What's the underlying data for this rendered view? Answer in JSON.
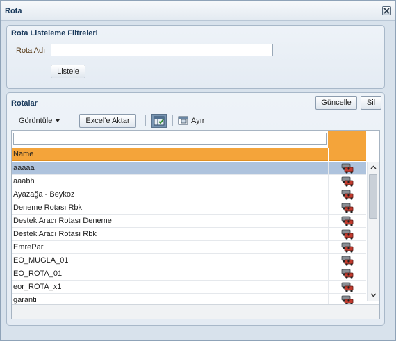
{
  "dialog": {
    "title": "Rota",
    "close_icon": "close-icon"
  },
  "filters": {
    "title": "Rota Listeleme Filtreleri",
    "route_name_label": "Rota Adı",
    "route_name_value": "",
    "list_button": "Listele"
  },
  "results": {
    "title": "Rotalar",
    "update_button": "Güncelle",
    "delete_button": "Sil",
    "toolbar": {
      "view_menu": "Görüntüle",
      "export_button": "Excel'e Aktar",
      "freeze_icon": "freeze-columns-icon",
      "detach_label": "Ayır",
      "detach_icon": "detach-icon"
    },
    "table": {
      "filter_value": "",
      "columns": [
        "Name",
        ""
      ],
      "row_action_icon": "route-vehicles-icon",
      "rows": [
        {
          "name": "aaaaa",
          "selected": true
        },
        {
          "name": "aaabh",
          "selected": false
        },
        {
          "name": "Ayazağa - Beykoz",
          "selected": false
        },
        {
          "name": "Deneme Rotası Rbk",
          "selected": false
        },
        {
          "name": "Destek Aracı Rotası Deneme",
          "selected": false
        },
        {
          "name": "Destek Aracı Rotası Rbk",
          "selected": false
        },
        {
          "name": "EmrePar",
          "selected": false
        },
        {
          "name": "EO_MUGLA_01",
          "selected": false
        },
        {
          "name": "EO_ROTA_01",
          "selected": false
        },
        {
          "name": "eor_ROTA_x1",
          "selected": false
        },
        {
          "name": "garanti",
          "selected": false
        }
      ]
    }
  },
  "colors": {
    "header_orange": "#f4a43a",
    "selected_row": "#aec3dd",
    "panel_bg": "#e4ebf3",
    "title_text": "#1a3a5c"
  }
}
